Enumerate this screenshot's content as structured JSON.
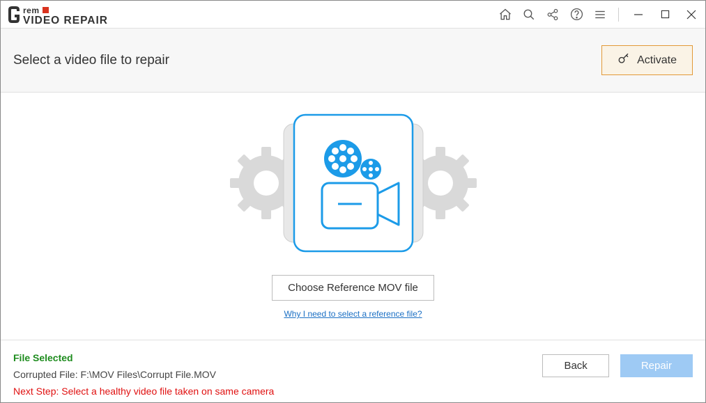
{
  "app": {
    "brand_top": "remo",
    "brand_main": "VIDEO REPAIR"
  },
  "subheader": {
    "page_title": "Select a video file to repair",
    "activate_label": "Activate"
  },
  "main": {
    "choose_button": "Choose Reference MOV file",
    "reference_link": "Why I need to select a reference file?"
  },
  "footer": {
    "file_selected_label": "File Selected",
    "corrupted_file_label": "Corrupted File: ",
    "corrupted_file_path": "F:\\MOV Files\\Corrupt File.MOV",
    "next_step": "Next Step: Select a healthy video file taken on same camera",
    "back_label": "Back",
    "repair_label": "Repair"
  }
}
